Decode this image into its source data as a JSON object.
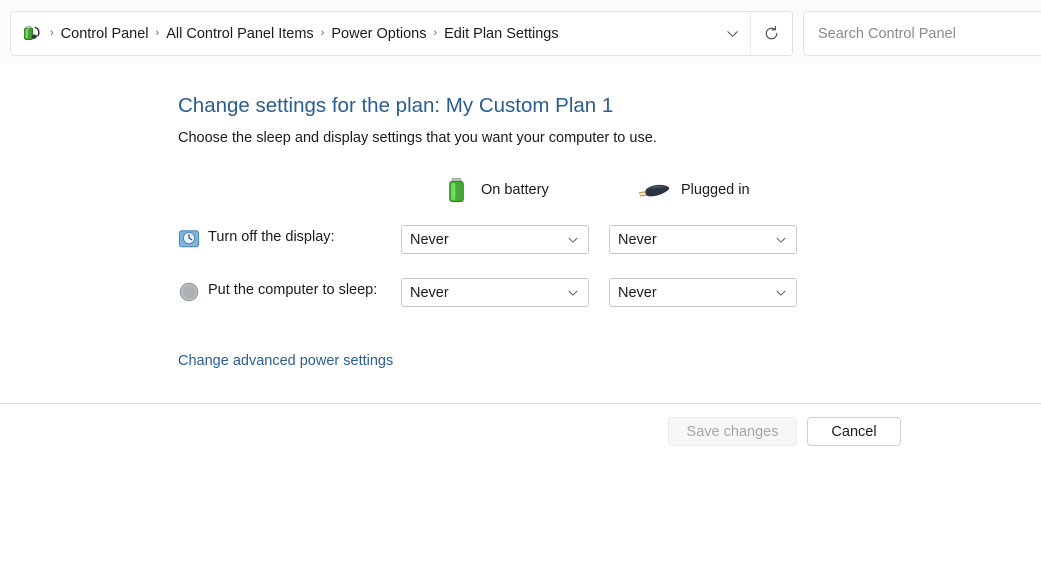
{
  "addressbar": {
    "icon": "power-options-icon",
    "breadcrumbs": [
      {
        "label": "Control Panel"
      },
      {
        "label": "All Control Panel Items"
      },
      {
        "label": "Power Options"
      },
      {
        "label": "Edit Plan Settings"
      }
    ],
    "separator": "›",
    "history_icon": "chevron-down-icon",
    "refresh_icon": "refresh-icon"
  },
  "search": {
    "placeholder": "Search Control Panel",
    "value": "",
    "icon": "search-icon"
  },
  "main": {
    "title": "Change settings for the plan: My Custom Plan 1",
    "subtitle": "Choose the sleep and display settings that you want your computer to use.",
    "columns": [
      {
        "label": "On battery",
        "icon": "battery-icon"
      },
      {
        "label": "Plugged in",
        "icon": "power-plug-icon"
      }
    ],
    "rows": [
      {
        "icon": "display-clock-icon",
        "label": "Turn off the display:",
        "on_battery": "Never",
        "plugged_in": "Never"
      },
      {
        "icon": "sleep-moon-icon",
        "label": "Put the computer to sleep:",
        "on_battery": "Never",
        "plugged_in": "Never"
      }
    ],
    "combo_arrow_icon": "chevron-down-icon",
    "advanced_link": "Change advanced power settings"
  },
  "footer": {
    "save_label": "Save changes",
    "save_disabled": true,
    "cancel_label": "Cancel"
  },
  "colors": {
    "link": "#2a5d93",
    "title": "#2a5d93",
    "text": "#1b1b1b",
    "battery_green": "#4caf3f",
    "disabled_text": "#a6a6a6"
  }
}
